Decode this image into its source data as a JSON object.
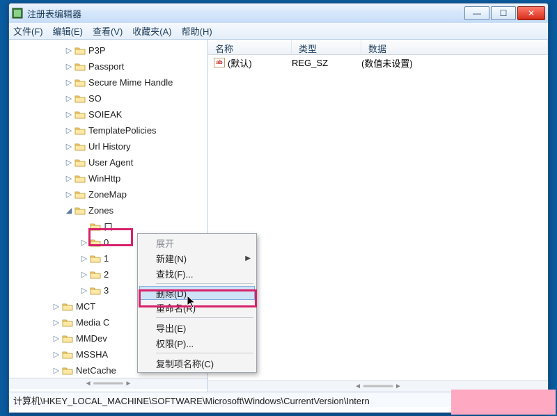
{
  "window": {
    "title": "注册表编辑器"
  },
  "menubar": {
    "file": "文件(F)",
    "edit": "编辑(E)",
    "view": "查看(V)",
    "favorites": "收藏夹(A)",
    "help": "帮助(H)"
  },
  "tree": {
    "items": [
      {
        "level": "indent-1",
        "exp": "▷",
        "label": "P3P"
      },
      {
        "level": "indent-1",
        "exp": "▷",
        "label": "Passport"
      },
      {
        "level": "indent-1",
        "exp": "▷",
        "label": "Secure Mime Handle"
      },
      {
        "level": "indent-1",
        "exp": "▷",
        "label": "SO"
      },
      {
        "level": "indent-1",
        "exp": "▷",
        "label": "SOIEAK"
      },
      {
        "level": "indent-1",
        "exp": "▷",
        "label": "TemplatePolicies"
      },
      {
        "level": "indent-1",
        "exp": "▷",
        "label": "Url History"
      },
      {
        "level": "indent-1",
        "exp": "▷",
        "label": "User Agent"
      },
      {
        "level": "indent-1",
        "exp": "▷",
        "label": "WinHttp"
      },
      {
        "level": "indent-1",
        "exp": "▷",
        "label": "ZoneMap"
      },
      {
        "level": "indent-1",
        "exp": "◢",
        "label": "Zones"
      },
      {
        "level": "indent-2",
        "exp": "",
        "label": "口"
      },
      {
        "level": "indent-2",
        "exp": "▷",
        "label": "0"
      },
      {
        "level": "indent-2",
        "exp": "▷",
        "label": "1"
      },
      {
        "level": "indent-2",
        "exp": "▷",
        "label": "2"
      },
      {
        "level": "indent-2",
        "exp": "▷",
        "label": "3"
      },
      {
        "level": "indent-parent",
        "exp": "▷",
        "label": "MCT"
      },
      {
        "level": "indent-parent",
        "exp": "▷",
        "label": "Media C"
      },
      {
        "level": "indent-parent",
        "exp": "▷",
        "label": "MMDev"
      },
      {
        "level": "indent-parent",
        "exp": "▷",
        "label": "MSSHA"
      },
      {
        "level": "indent-parent",
        "exp": "▷",
        "label": "NetCache"
      }
    ]
  },
  "list": {
    "columns": {
      "name": "名称",
      "type": "类型",
      "data": "数据"
    },
    "rows": [
      {
        "name": "(默认)",
        "type": "REG_SZ",
        "data": "(数值未设置)"
      }
    ]
  },
  "context_menu": {
    "expand": "展开",
    "new": "新建(N)",
    "find": "查找(F)...",
    "delete": "删除(D)",
    "rename": "重命名(R)",
    "export": "导出(E)",
    "permissions": "权限(P)...",
    "copy_key_name": "复制项名称(C)"
  },
  "statusbar": {
    "path": "计算机\\HKEY_LOCAL_MACHINE\\SOFTWARE\\Microsoft\\Windows\\CurrentVersion\\Intern"
  }
}
